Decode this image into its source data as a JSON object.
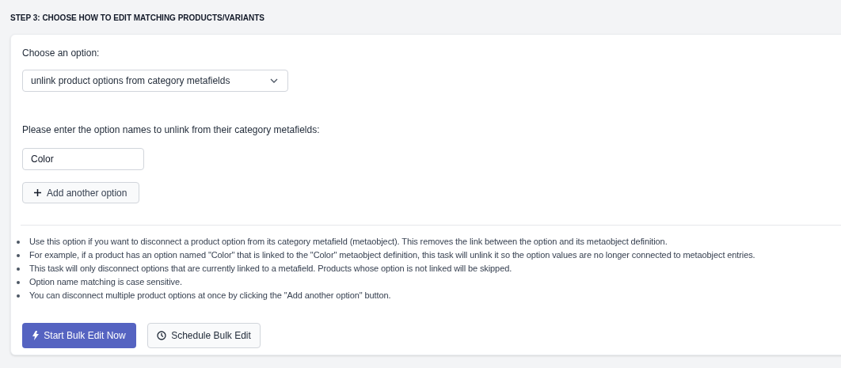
{
  "heading": "STEP 3: CHOOSE HOW TO EDIT MATCHING PRODUCTS/VARIANTS",
  "choose_label": "Choose an option:",
  "option_select": {
    "value": "unlink product options from category metafields"
  },
  "names_label": "Please enter the option names to unlink from their category metafields:",
  "option_inputs": [
    {
      "value": "Color"
    }
  ],
  "add_button": "Add another option",
  "notes": [
    "Use this option if you want to disconnect a product option from its category metafield (metaobject). This removes the link between the option and its metaobject definition.",
    "For example, if a product has an option named \"Color\" that is linked to the \"Color\" metaobject definition, this task will unlink it so the option values are no longer connected to metaobject entries.",
    "This task will only disconnect options that are currently linked to a metafield. Products whose option is not linked will be skipped.",
    "Option name matching is case sensitive.",
    "You can disconnect multiple product options at once by clicking the \"Add another option\" button."
  ],
  "actions": [
    {
      "kind": "primary",
      "label": "Start Bulk Edit Now"
    },
    {
      "kind": "secondary",
      "label": "Schedule Bulk Edit"
    }
  ]
}
